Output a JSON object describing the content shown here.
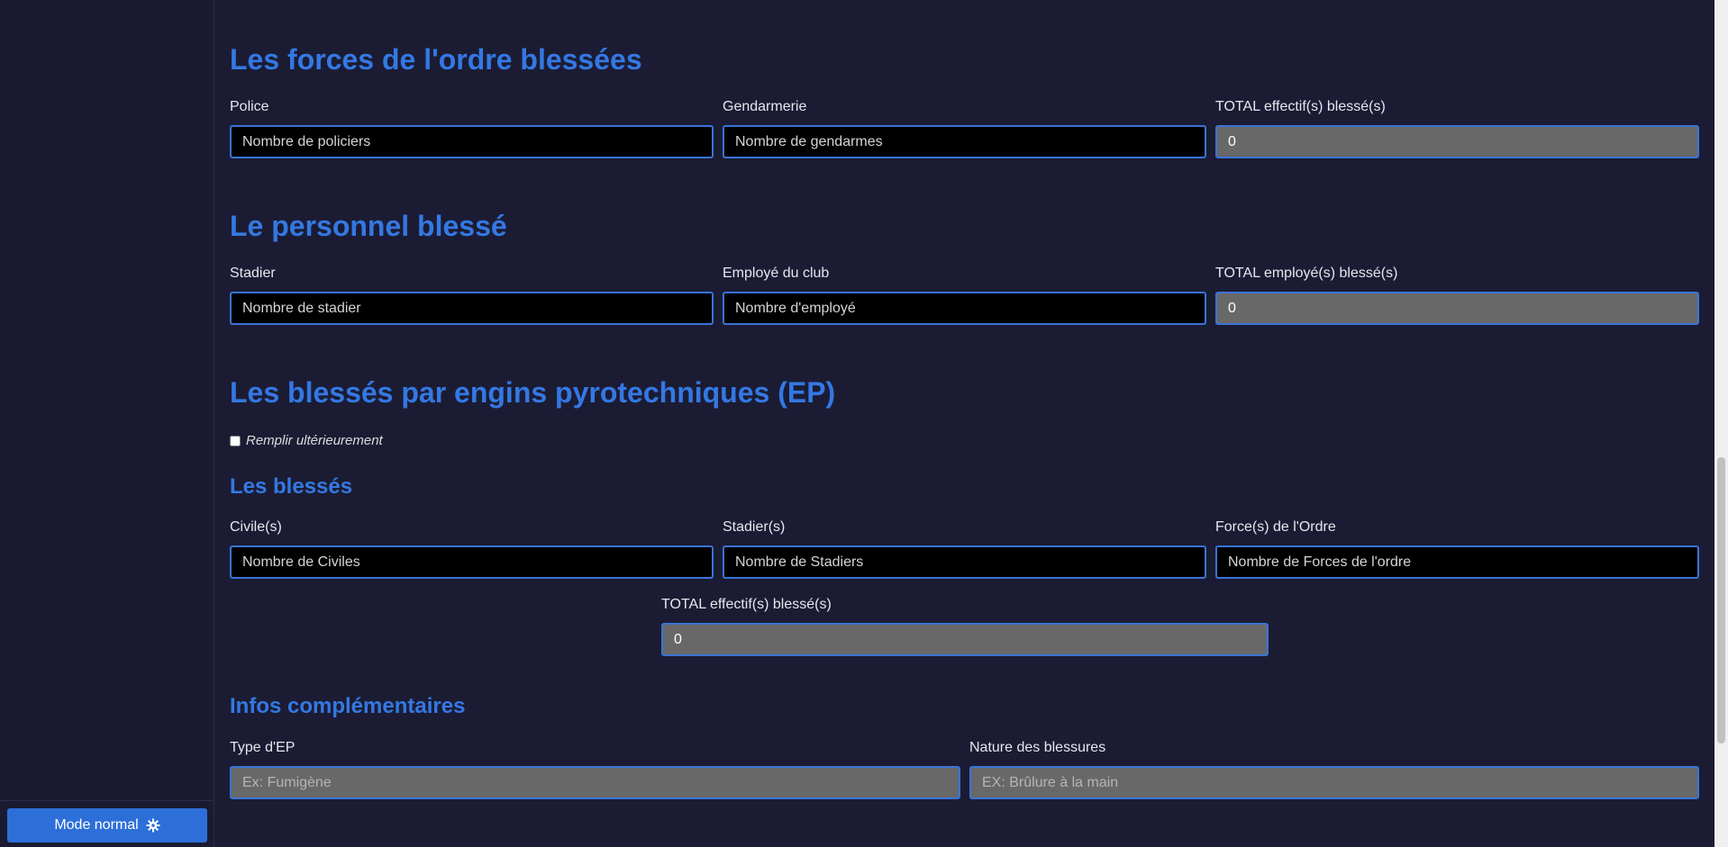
{
  "sidebar": {
    "mode_button_label": "Mode normal",
    "mode_button_icon": "gear-icon"
  },
  "forces": {
    "title": "Les forces de l'ordre blessées",
    "police_label": "Police",
    "police_placeholder": "Nombre de policiers",
    "gendarmerie_label": "Gendarmerie",
    "gendarmerie_placeholder": "Nombre de gendarmes",
    "total_label": "TOTAL effectif(s) blessé(s)",
    "total_value": "0"
  },
  "personnel": {
    "title": "Le personnel blessé",
    "stadier_label": "Stadier",
    "stadier_placeholder": "Nombre de stadier",
    "employe_label": "Employé du club",
    "employe_placeholder": "Nombre d'employé",
    "total_label": "TOTAL employé(s) blessé(s)",
    "total_value": "0"
  },
  "ep": {
    "title": "Les blessés par engins pyrotechniques (EP)",
    "checkbox_label": "Remplir ultérieurement",
    "checkbox_checked": false,
    "blesses_title": "Les blessés",
    "civiles_label": "Civile(s)",
    "civiles_placeholder": "Nombre de Civiles",
    "stadiers_label": "Stadier(s)",
    "stadiers_placeholder": "Nombre de Stadiers",
    "forces_label": "Force(s) de l'Ordre",
    "forces_placeholder": "Nombre de Forces de l'ordre",
    "total_label": "TOTAL effectif(s) blessé(s)",
    "total_value": "0",
    "infos_title": "Infos complémentaires",
    "type_label": "Type d'EP",
    "type_placeholder": "Ex: Fumigène",
    "nature_label": "Nature des blessures",
    "nature_placeholder": "EX: Brûlure à la main"
  },
  "colors": {
    "background": "#1b1c34",
    "accent": "#3478e3",
    "button": "#2d6fd8",
    "input_border": "#3a74d6",
    "readonly_bg": "#686868"
  }
}
